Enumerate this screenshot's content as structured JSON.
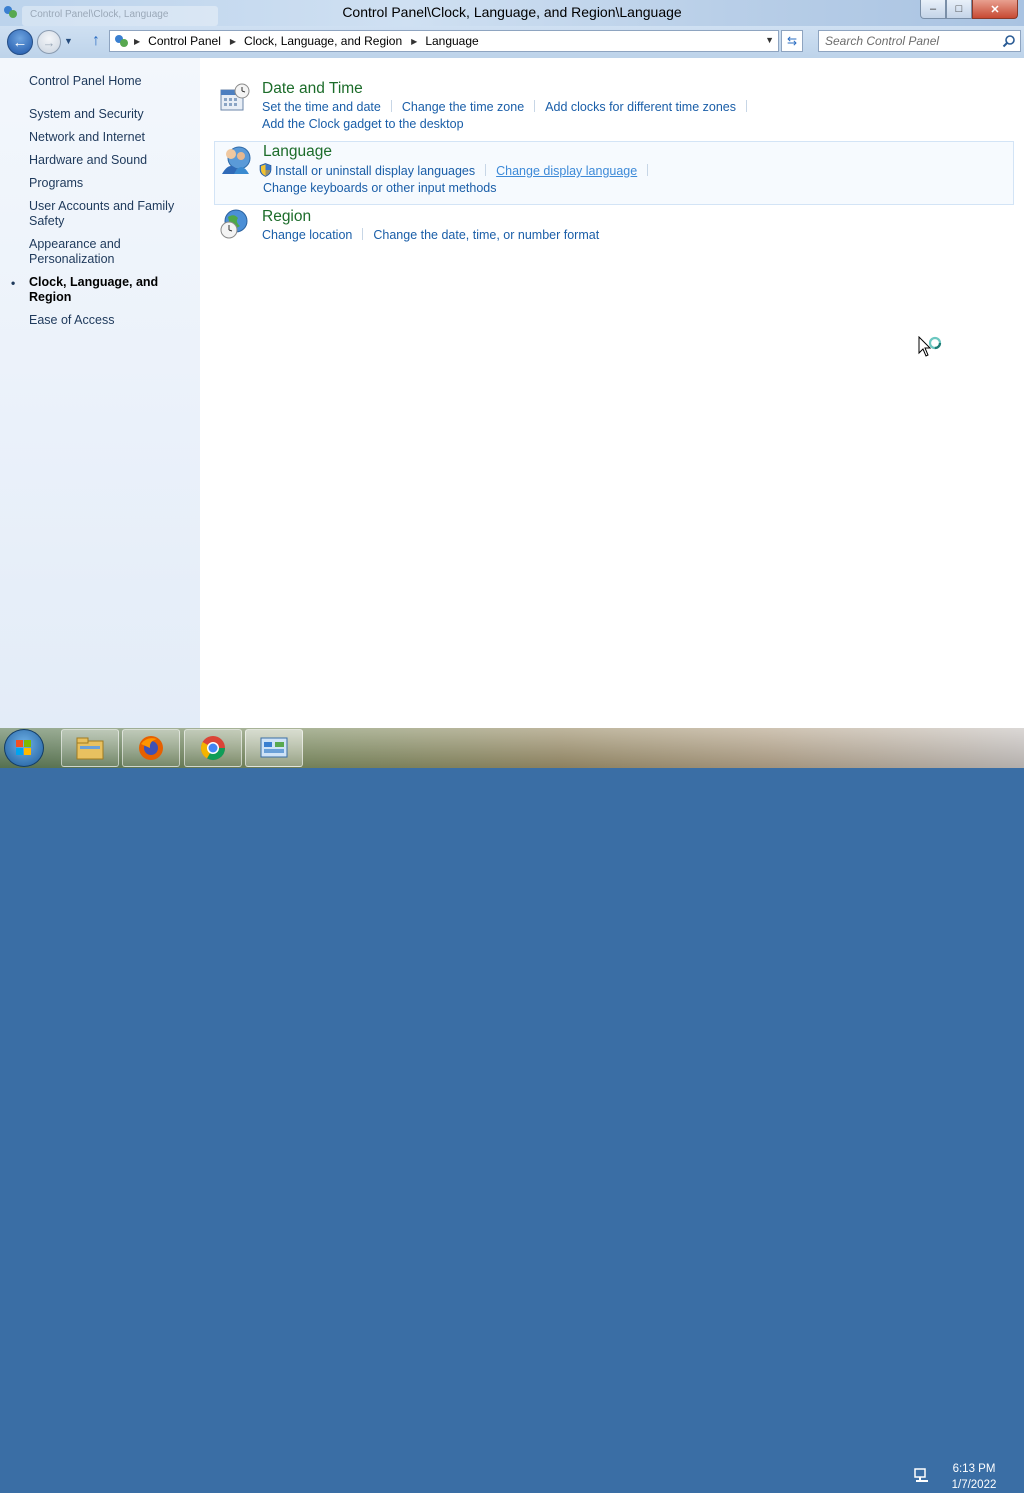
{
  "window": {
    "title": "Control Panel\\Clock, Language, and Region\\Language",
    "ghost_tab": "Control Panel\\Clock, Language",
    "minimize_glyph": "–",
    "maximize_glyph": "□",
    "close_glyph": "✕"
  },
  "nav": {
    "back_glyph": "←",
    "forward_glyph": "→",
    "up_glyph": "↑",
    "breadcrumbs": [
      "Control Panel",
      "Clock, Language, and Region",
      "Language"
    ],
    "refresh_glyph": "⇆",
    "search_placeholder": "Search Control Panel"
  },
  "sidebar": {
    "home": "Control Panel Home",
    "items": [
      {
        "label": "System and Security",
        "active": false
      },
      {
        "label": "Network and Internet",
        "active": false
      },
      {
        "label": "Hardware and Sound",
        "active": false
      },
      {
        "label": "Programs",
        "active": false
      },
      {
        "label": "User Accounts and Family Safety",
        "active": false
      },
      {
        "label": "Appearance and Personalization",
        "active": false
      },
      {
        "label": "Clock, Language, and Region",
        "active": true
      },
      {
        "label": "Ease of Access",
        "active": false
      }
    ],
    "active_bullet": "•"
  },
  "categories": {
    "date_time": {
      "title": "Date and Time",
      "icon": "calendar-clock-icon",
      "links": [
        "Set the time and date",
        "Change the time zone",
        "Add clocks for different time zones"
      ],
      "links2": [
        "Add the Clock gadget to the desktop"
      ]
    },
    "language": {
      "title": "Language",
      "icon": "language-people-icon",
      "links": [
        "Install or uninstall display languages",
        "Change display language"
      ],
      "links2": [
        "Change keyboards or other input methods"
      ]
    },
    "region": {
      "title": "Region",
      "icon": "globe-clock-icon",
      "links": [
        "Change location",
        "Change the date, time, or number format"
      ]
    }
  },
  "taskbar": {
    "time": "6:13 PM",
    "date": "1/7/2022",
    "pinned": [
      "file-explorer-icon",
      "firefox-icon",
      "chrome-icon",
      "control-panel-icon"
    ]
  },
  "colors": {
    "link": "#1a5ea8",
    "category_title": "#1c6c2a",
    "sidebar_text": "#1e395b"
  }
}
